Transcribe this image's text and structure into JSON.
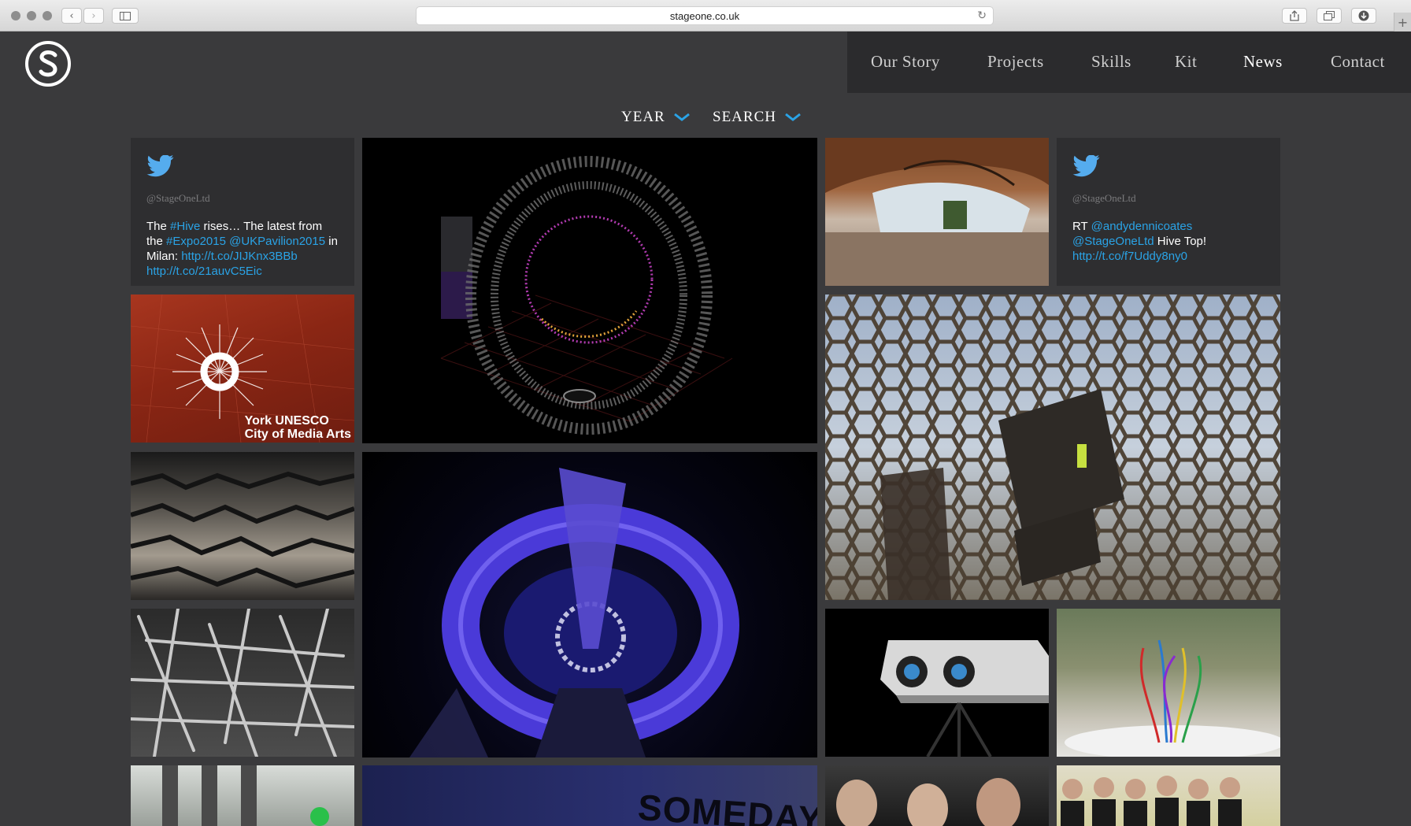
{
  "browser": {
    "url": "stageone.co.uk"
  },
  "nav": {
    "items": [
      {
        "label": "Our Story"
      },
      {
        "label": "Projects"
      },
      {
        "label": "Skills"
      },
      {
        "label": "Kit"
      },
      {
        "label": "News",
        "active": true
      },
      {
        "label": "Contact"
      }
    ]
  },
  "filters": {
    "year_label": "YEAR",
    "search_label": "SEARCH"
  },
  "colors": {
    "page_bg": "#3a3a3c",
    "nav_bg": "#2b2b2d",
    "accent_blue": "#2aa3e6",
    "twitter_blue": "#55acee"
  },
  "tweets": [
    {
      "handle": "@StageOneLtd",
      "parts": [
        {
          "t": "The ",
          "link": false
        },
        {
          "t": "#Hive",
          "link": true
        },
        {
          "t": " rises… The latest from the ",
          "link": false
        },
        {
          "t": "#Expo2015",
          "link": true
        },
        {
          "t": " ",
          "link": false
        },
        {
          "t": "@UKPavilion2015",
          "link": true
        },
        {
          "t": " in Milan: ",
          "link": false
        },
        {
          "t": "http://t.co/JIJKnx3BBb",
          "link": true
        },
        {
          "t": " ",
          "link": false
        },
        {
          "t": "http://t.co/21auvC5Eic",
          "link": true
        }
      ]
    },
    {
      "handle": "@StageOneLtd",
      "parts": [
        {
          "t": "RT ",
          "link": false
        },
        {
          "t": "@andydennicoates",
          "link": true
        },
        {
          "t": " ",
          "link": false
        },
        {
          "t": "@StageOneLtd",
          "link": true
        },
        {
          "t": " Hive Top! ",
          "link": false
        },
        {
          "t": "http://t.co/f7Uddy8ny0",
          "link": true
        }
      ]
    }
  ],
  "york_caption": {
    "line1": "York UNESCO",
    "line2": "City of Media Arts"
  },
  "someday_text": "SOMEDAY"
}
